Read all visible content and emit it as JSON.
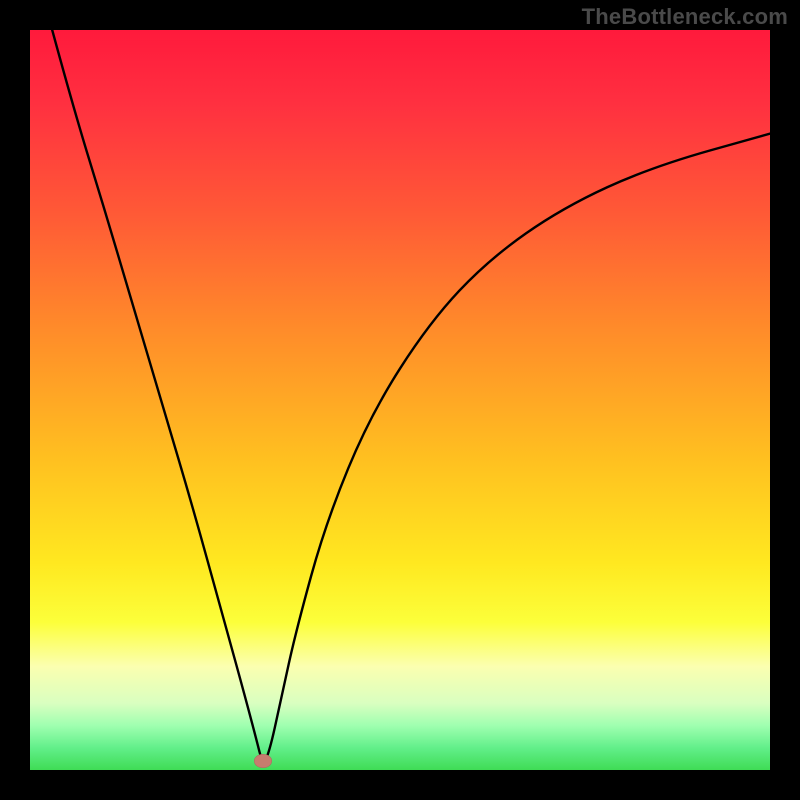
{
  "watermark": "TheBottleneck.com",
  "colors": {
    "frame": "#000000",
    "curve": "#000000",
    "marker": "#c77c6e",
    "gradient_top": "#ff1a3c",
    "gradient_bottom": "#3fdc55"
  },
  "chart_data": {
    "type": "line",
    "title": "",
    "xlabel": "",
    "ylabel": "",
    "xlim": [
      0,
      100
    ],
    "ylim": [
      0,
      100
    ],
    "grid": false,
    "note": "V-shaped bottleneck curve; y≈0 is optimal (green), y≈100 is worst (red). Minimum near x≈31.5.",
    "series": [
      {
        "name": "bottleneck-curve",
        "x": [
          3,
          6,
          10,
          14,
          18,
          22,
          26,
          28.5,
          30.5,
          31.5,
          32.5,
          34,
          36,
          40,
          46,
          54,
          62,
          72,
          84,
          100
        ],
        "y": [
          100,
          89,
          76,
          62.5,
          49,
          35.5,
          21,
          12,
          4.5,
          0.5,
          3,
          10,
          19,
          33.5,
          48,
          60.5,
          69,
          76,
          81.5,
          86
        ]
      }
    ],
    "marker": {
      "x": 31.5,
      "y": 1.2
    }
  }
}
